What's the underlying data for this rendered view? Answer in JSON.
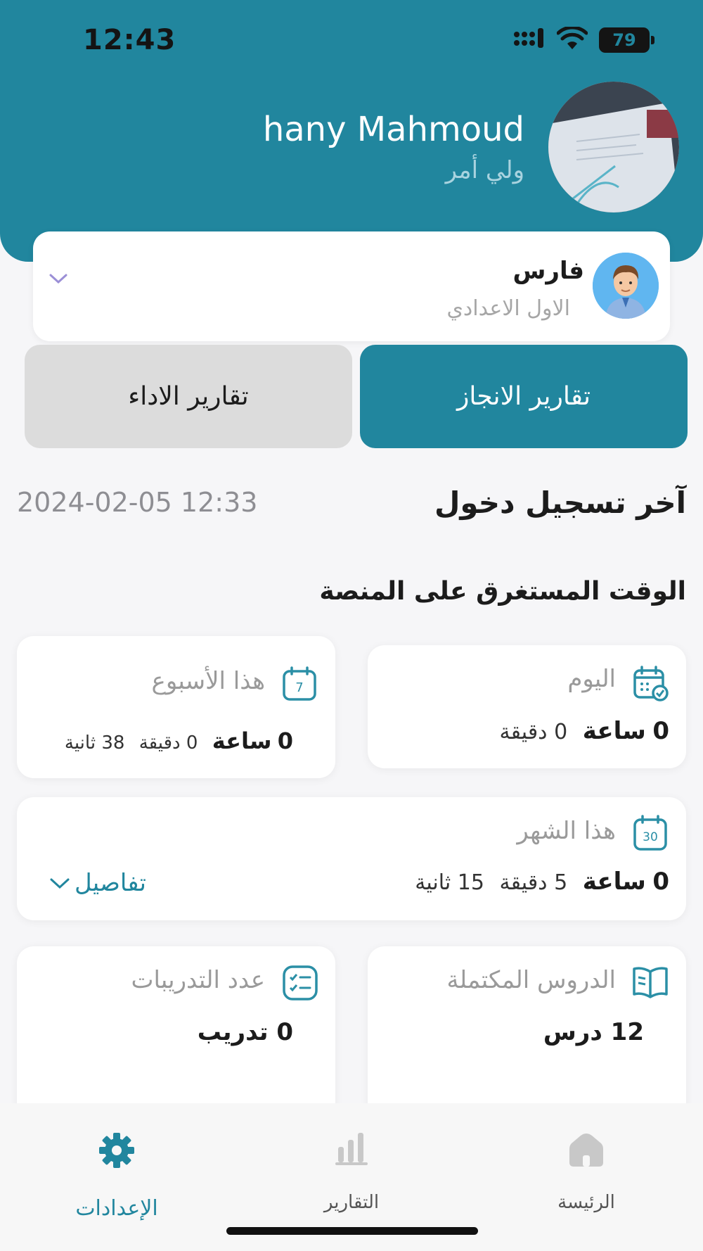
{
  "status_bar": {
    "time": "12:43",
    "battery": "79"
  },
  "profile": {
    "name": "hany Mahmoud",
    "role": "ولي أمر"
  },
  "student": {
    "name": "فارس",
    "grade": "الاول الاعدادي"
  },
  "tabs": {
    "active": "تقارير الانجاز",
    "inactive": "تقارير الاداء"
  },
  "last_login": {
    "title": "آخر تسجيل دخول",
    "date": "2024-02-05 12:33"
  },
  "time_section": {
    "title": "الوقت المستغرق على المنصة"
  },
  "cards": {
    "today": {
      "title": "اليوم",
      "hours": "0",
      "hours_label": "ساعة",
      "minutes": "0",
      "minutes_label": "دقيقة"
    },
    "week": {
      "title": "هذا الأسبوع",
      "hours": "0",
      "hours_label": "ساعة",
      "minutes": "0",
      "minutes_label": "دقيقة",
      "seconds": "38",
      "seconds_label": "ثانية"
    },
    "month": {
      "title": "هذا الشهر",
      "hours": "0",
      "hours_label": "ساعة",
      "minutes": "5",
      "minutes_label": "دقيقة",
      "seconds": "15",
      "seconds_label": "ثانية",
      "details": "تفاصيل"
    },
    "lessons": {
      "title": "الدروس المكتملة",
      "value": "12 درس"
    },
    "trainings": {
      "title": "عدد التدريبات",
      "value": "0 تدريب"
    }
  },
  "icons": {
    "week_day": "7",
    "month_day": "30"
  },
  "nav": {
    "settings": "الإعدادات",
    "reports": "التقارير",
    "home": "الرئيسة"
  },
  "colors": {
    "primary": "#21869e",
    "background": "#f6f6f8",
    "inactive_tab": "#dcdcdc"
  }
}
